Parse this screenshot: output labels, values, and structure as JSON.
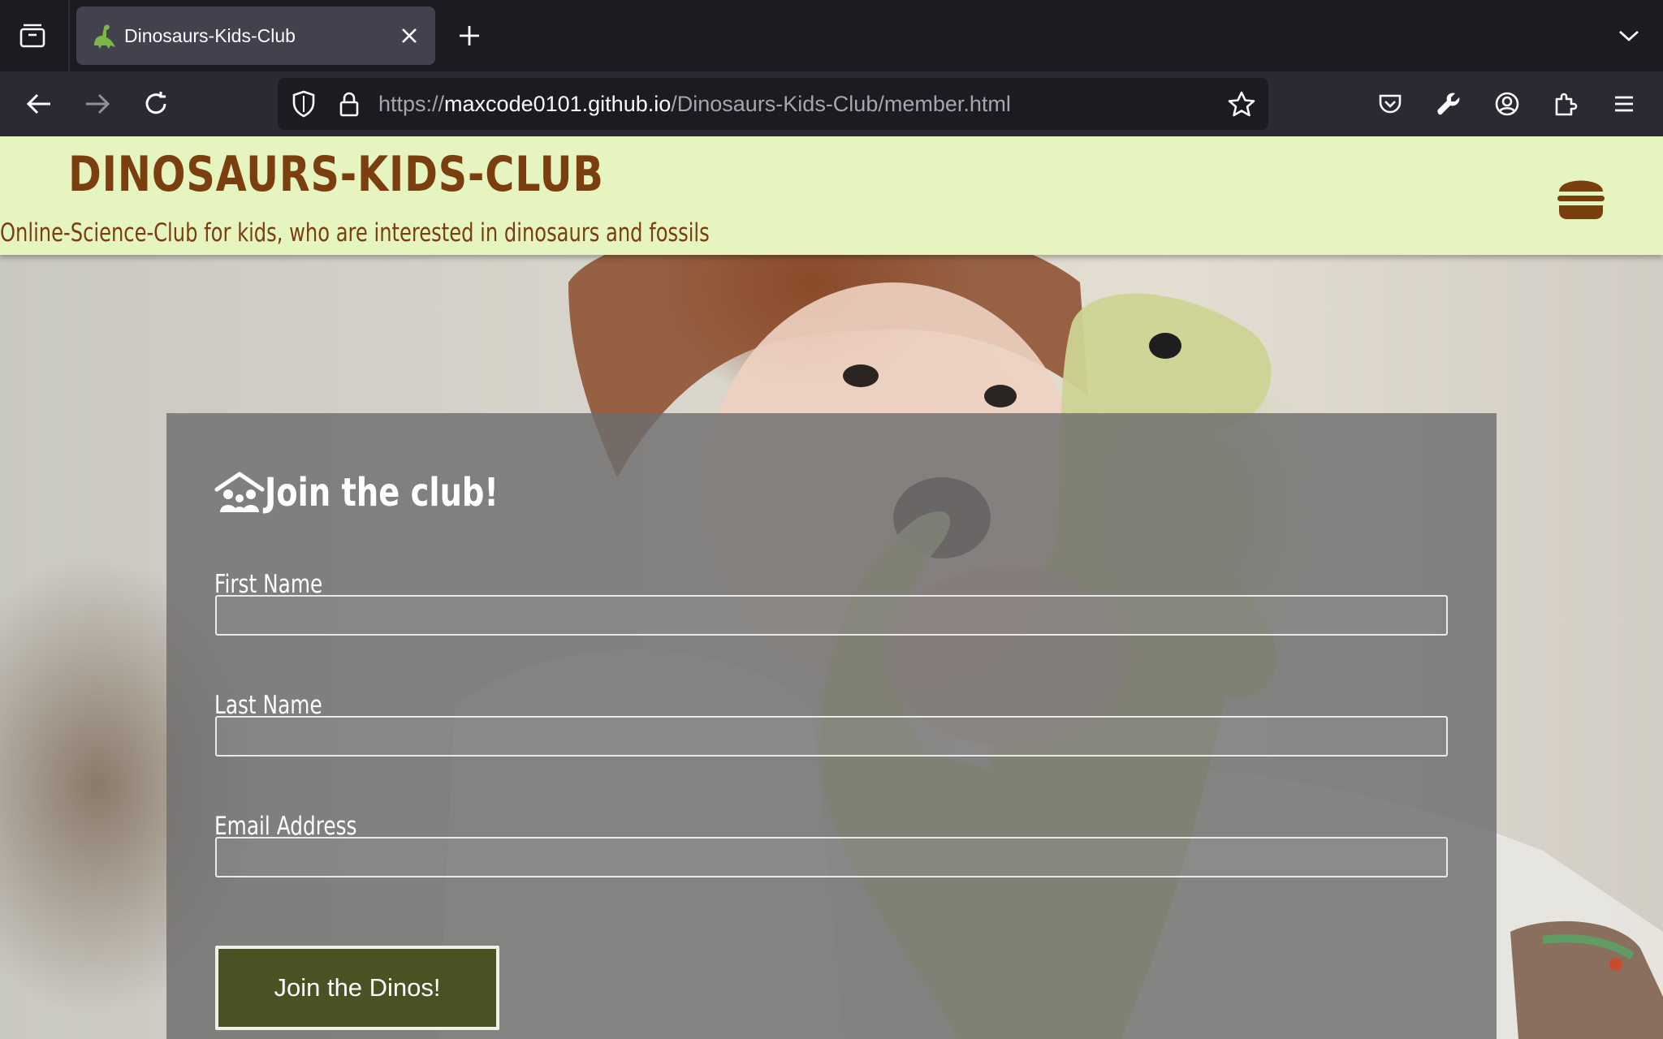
{
  "browser": {
    "tab": {
      "title": "Dinosaurs-Kids-Club"
    },
    "url": {
      "scheme": "https://",
      "host": "maxcode0101.github.io",
      "path": "/Dinosaurs-Kids-Club/member.html"
    }
  },
  "header": {
    "title": "DINOSAURS-KIDS-CLUB",
    "subtitle": "Online-Science-Club for kids, who are interested in dinosaurs and fossils"
  },
  "form": {
    "heading": "Join the club!",
    "fields": [
      {
        "label": "First Name",
        "value": ""
      },
      {
        "label": "Last Name",
        "value": ""
      },
      {
        "label": "Email Address",
        "value": ""
      }
    ],
    "submit_label": "Join the Dinos!"
  },
  "colors": {
    "header_bg": "#e6f5c0",
    "brand_brown": "#7a3e0f",
    "button_bg": "#4a5224",
    "panel_bg": "rgba(110,110,110,0.82)"
  },
  "icons": [
    "tab-overview-icon",
    "dino-favicon-icon",
    "close-icon",
    "plus-icon",
    "chevron-down-icon",
    "back-arrow-icon",
    "forward-arrow-icon",
    "reload-icon",
    "shield-icon",
    "lock-icon",
    "star-icon",
    "pocket-icon",
    "wrench-icon",
    "account-icon",
    "extensions-icon",
    "menu-icon",
    "burger-icon",
    "house-family-icon"
  ]
}
